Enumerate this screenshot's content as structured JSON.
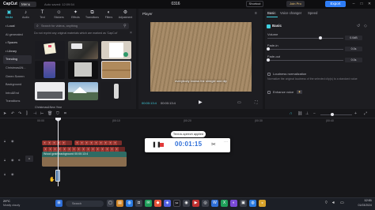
{
  "titlebar": {
    "logo": "CapCut",
    "menu": "Menu",
    "autosave": "Auto saved: 12:09:54",
    "title": "0316",
    "shortcut": "Shortcut",
    "join_pro": "Join Pro",
    "export": "Export",
    "win_min": "–",
    "win_max": "□",
    "win_close": "✕"
  },
  "left_tabs": [
    {
      "label": "Media",
      "glyph": "▣"
    },
    {
      "label": "Audio",
      "glyph": "♪"
    },
    {
      "label": "Text",
      "glyph": "T"
    },
    {
      "label": "Stickers",
      "glyph": "☺"
    },
    {
      "label": "Effects",
      "glyph": "✦"
    },
    {
      "label": "Transitions",
      "glyph": "⧉"
    },
    {
      "label": "Filters",
      "glyph": "◐"
    },
    {
      "label": "Adjustment",
      "glyph": "⚙"
    }
  ],
  "sidenav": [
    "• Local",
    "AI generated",
    "• Spaces",
    "• Library",
    "Trending",
    "Christmas&N...",
    "Green Screen",
    "Background",
    "Intro&End",
    "Transitions"
  ],
  "search": {
    "placeholder": "Search for videos, anything"
  },
  "notice": "Do not reprint any original materials which are marked as 'CapCut'",
  "media_captions": {
    "christmas": "Christmas&New Year"
  },
  "player": {
    "title": "Player",
    "subtitle": "everybody knows the shingle and dip",
    "time_current": "00:00:13:4",
    "time_total": "00:00:13:4"
  },
  "right_panel": {
    "tabs": [
      "Basic",
      "Voice changer",
      "Speed"
    ],
    "section": "Basic",
    "volume_label": "Volume",
    "volume_value": "0.0dB",
    "volume_level": 0.7,
    "fadein_label": "Fade-in",
    "fadein_value": "0.0s",
    "fadeout_label": "Fade-out",
    "fadeout_value": "0.0s",
    "loudness_label": "Loudness normalization",
    "loudness_desc": "Normalize the original loudness of the selected clip(s) to a standard value",
    "enhance_label": "Enhance voice"
  },
  "timeline": {
    "ruler": [
      "00:00",
      "|00:10",
      "|00:20",
      "|00:30",
      "|00:40",
      "|00:50",
      "|01:00"
    ],
    "audio_clip_label": "Wood grain background  00:00:13:4",
    "tts_toast": "Text-to-speech applied",
    "recording_time": "00:01:15"
  },
  "taskbar": {
    "temp": "29°C",
    "weather": "Mostly cloudy",
    "search": "Search",
    "clock": "12:01",
    "date": "01/03/2024"
  },
  "colors": {
    "accent": "#3fd0e0",
    "export": "#2e7df6",
    "record": "#e23a3a"
  }
}
